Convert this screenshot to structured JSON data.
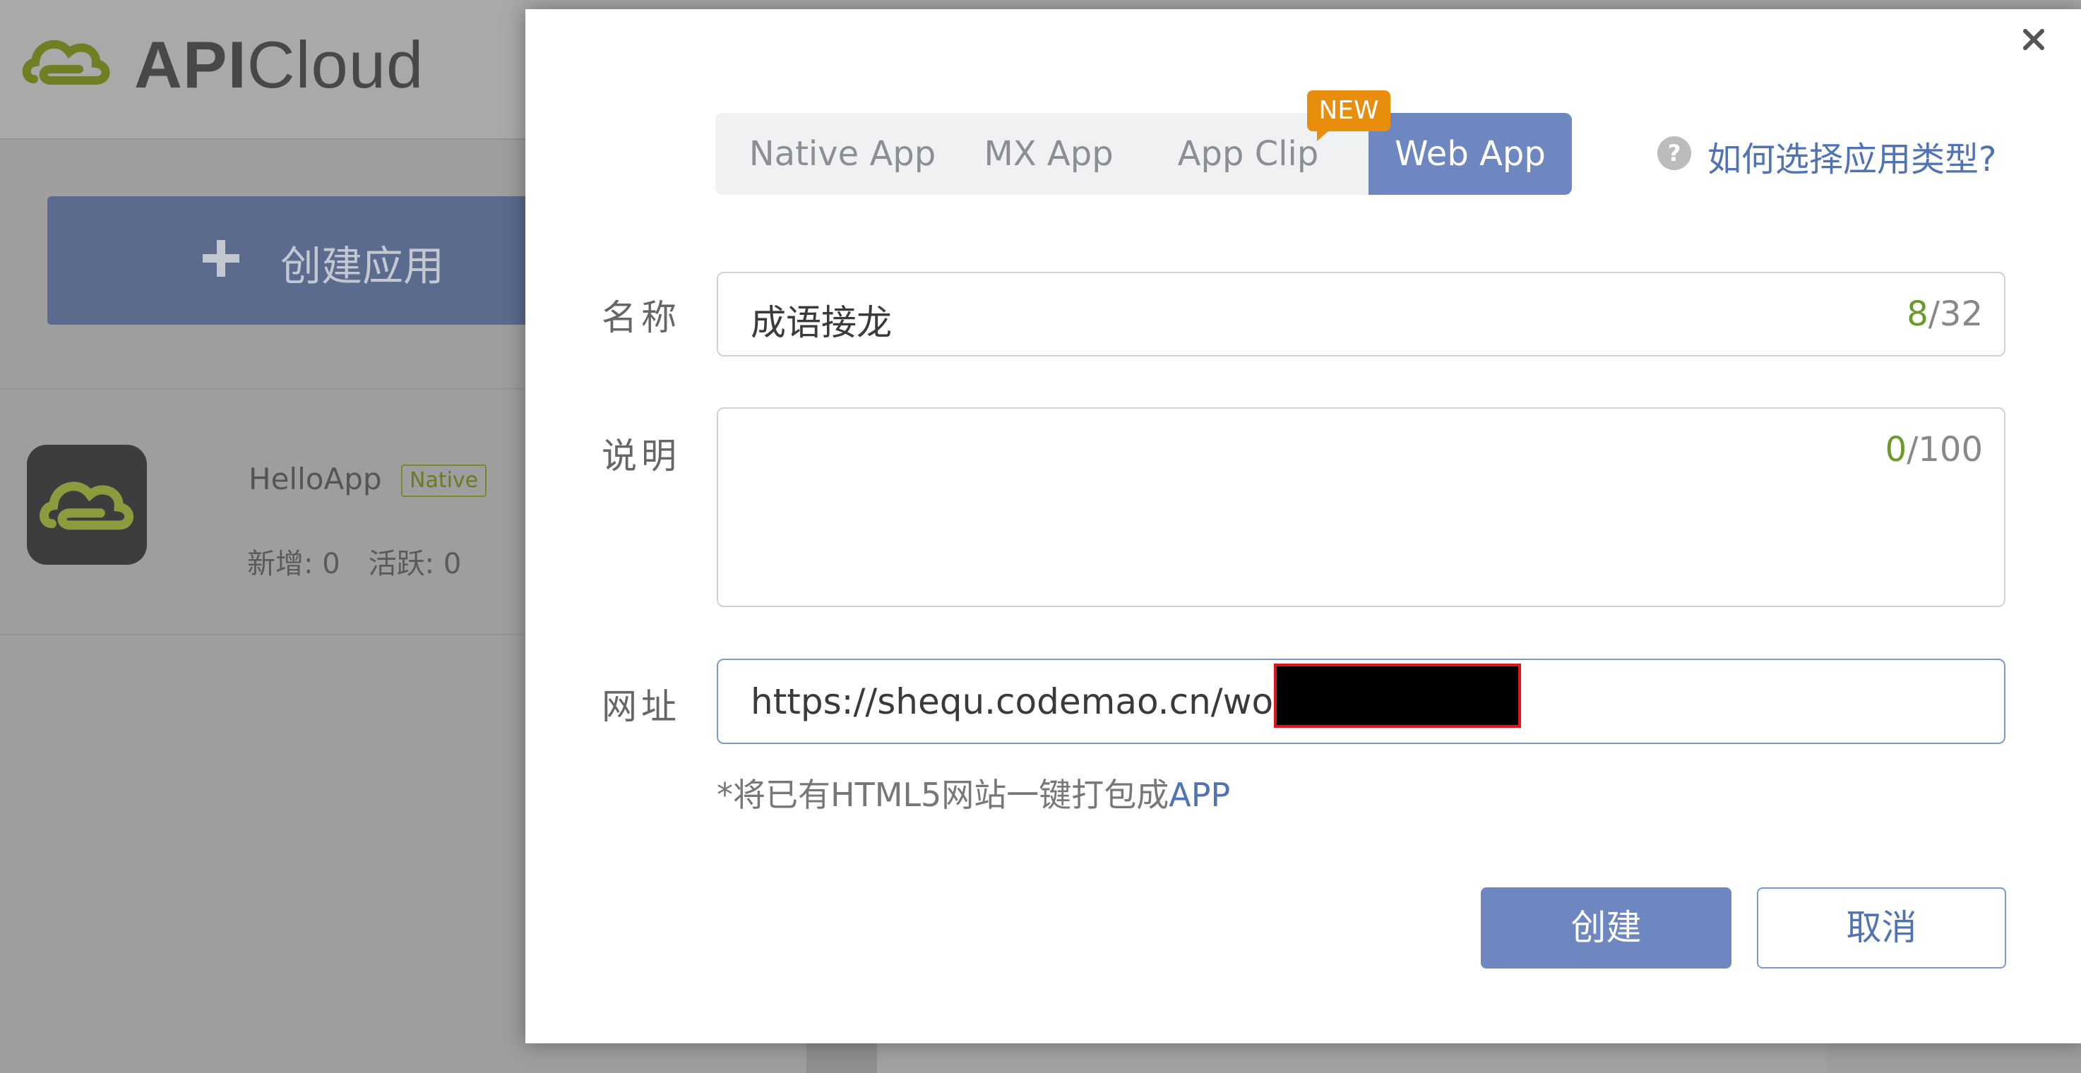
{
  "background": {
    "logo": {
      "api": "API",
      "cloud": "Cloud"
    },
    "create_button_label": "创建应用",
    "app": {
      "name": "HelloApp",
      "badge": "Native",
      "new_label": "新增: 0",
      "active_label": "活跃: 0"
    }
  },
  "modal": {
    "tabs": [
      {
        "label": "Native App"
      },
      {
        "label": "MX App"
      },
      {
        "label": "App Clip"
      },
      {
        "label": "Web App"
      }
    ],
    "active_tab": "Web App",
    "new_badge": "NEW",
    "help_text": "如何选择应用类型?",
    "fields": {
      "name": {
        "label": "名称",
        "value": "成语接龙",
        "count": "8",
        "max": "/32"
      },
      "description": {
        "label": "说明",
        "value": "",
        "count": "0",
        "max": "/100"
      },
      "url": {
        "label": "网址",
        "value": "https://shequ.codemao.cn/wor"
      }
    },
    "hint_text": "*将已有HTML5网站一键打包成",
    "hint_highlight": "APP",
    "create_label": "创建",
    "cancel_label": "取消"
  },
  "colors": {
    "accent": "#6e87c0",
    "link": "#4f73b5",
    "new_badge": "#e88d0c",
    "counter_current": "#6a9b2a"
  },
  "icons": {
    "logo": "cloud-logo-icon",
    "plus": "plus-icon",
    "help": "question-circle-icon",
    "close": "close-icon"
  }
}
